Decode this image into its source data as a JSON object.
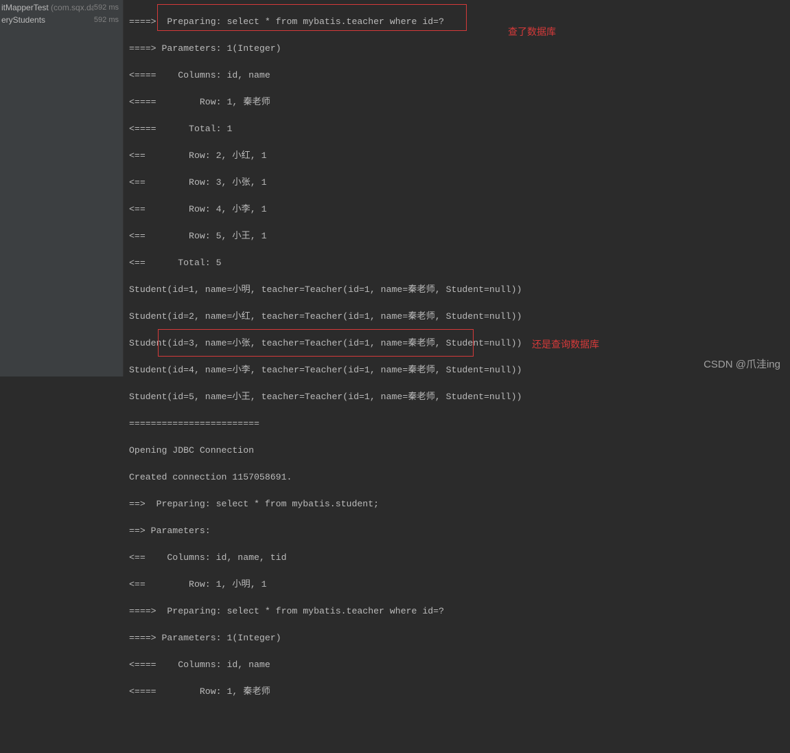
{
  "sidebar": {
    "items": [
      {
        "name": "itMapperTest",
        "pkg": "(com.sqx.da",
        "time": "592 ms"
      },
      {
        "name": "eryStudents",
        "pkg": "",
        "time": "592 ms"
      }
    ]
  },
  "console": {
    "lines": [
      "====>  Preparing: select * from mybatis.teacher where id=?",
      "====> Parameters: 1(Integer)",
      "<====    Columns: id, name",
      "<====        Row: 1, 秦老师",
      "<====      Total: 1",
      "<==        Row: 2, 小红, 1",
      "<==        Row: 3, 小张, 1",
      "<==        Row: 4, 小李, 1",
      "<==        Row: 5, 小王, 1",
      "<==      Total: 5",
      "Student(id=1, name=小明, teacher=Teacher(id=1, name=秦老师, Student=null))",
      "Student(id=2, name=小红, teacher=Teacher(id=1, name=秦老师, Student=null))",
      "Student(id=3, name=小张, teacher=Teacher(id=1, name=秦老师, Student=null))",
      "Student(id=4, name=小李, teacher=Teacher(id=1, name=秦老师, Student=null))",
      "Student(id=5, name=小王, teacher=Teacher(id=1, name=秦老师, Student=null))",
      "========================",
      "Opening JDBC Connection",
      "Created connection 1157058691.",
      "==>  Preparing: select * from mybatis.student;",
      "==> Parameters: ",
      "<==    Columns: id, name, tid",
      "<==        Row: 1, 小明, 1",
      "====>  Preparing: select * from mybatis.teacher where id=?",
      "====> Parameters: 1(Integer)",
      "<====    Columns: id, name",
      "<====        Row: 1, 秦老师"
    ]
  },
  "annotations": {
    "top": "查了数据库",
    "bottom": "还是查询数据库"
  },
  "watermark": "CSDN @爪洼ing"
}
